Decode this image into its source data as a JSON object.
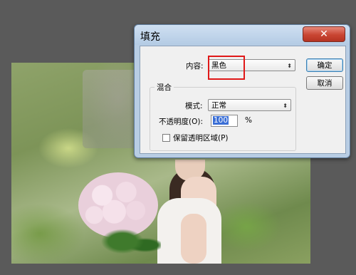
{
  "dialog": {
    "title": "填充",
    "close_label": "✕",
    "content_label": "内容:",
    "content_value": "黑色",
    "blend_group_label": "混合",
    "mode_label": "模式:",
    "mode_value": "正常",
    "opacity_label": "不透明度(O):",
    "opacity_value": "100",
    "opacity_unit": "%",
    "preserve_transparency_label": "保留透明区域(P)",
    "preserve_transparency_checked": false,
    "ok_label": "确定",
    "cancel_label": "取消",
    "dropdown_arrow": "⬍",
    "highlight_color": "#e01818"
  }
}
